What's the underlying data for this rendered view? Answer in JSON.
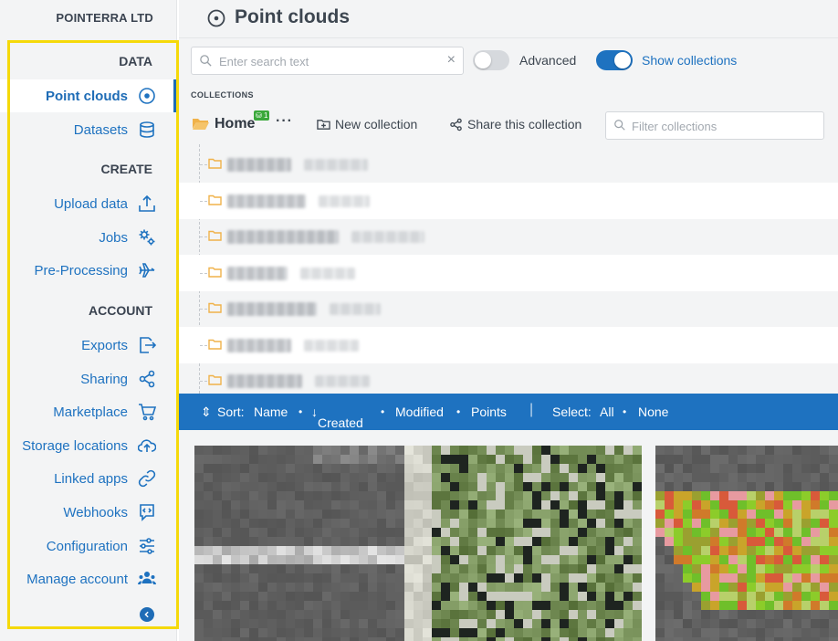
{
  "sidebar": {
    "org_name": "POINTERRA LTD",
    "sections": {
      "data": "DATA",
      "create": "CREATE",
      "account": "ACCOUNT"
    },
    "items": [
      {
        "label": "Point clouds",
        "icon": "target-icon",
        "active": true
      },
      {
        "label": "Datasets",
        "icon": "database-icon"
      },
      {
        "label": "Upload data",
        "icon": "upload-icon"
      },
      {
        "label": "Jobs",
        "icon": "gears-icon"
      },
      {
        "label": "Pre-Processing",
        "icon": "plane-icon"
      },
      {
        "label": "Exports",
        "icon": "export-icon"
      },
      {
        "label": "Sharing",
        "icon": "share-icon"
      },
      {
        "label": "Marketplace",
        "icon": "cart-icon"
      },
      {
        "label": "Storage locations",
        "icon": "cloud-upload-icon"
      },
      {
        "label": "Linked apps",
        "icon": "link-icon"
      },
      {
        "label": "Webhooks",
        "icon": "webhook-icon"
      },
      {
        "label": "Configuration",
        "icon": "sliders-icon"
      },
      {
        "label": "Manage account",
        "icon": "users-icon"
      }
    ],
    "collapse_icon": "chevron-left-icon"
  },
  "header": {
    "title": "Point clouds",
    "icon": "target-icon"
  },
  "toolbar": {
    "search_placeholder": "Enter search text",
    "advanced_label": "Advanced",
    "advanced_on": false,
    "show_collections_label": "Show collections",
    "show_collections_on": true
  },
  "collections": {
    "caption": "COLLECTIONS",
    "home_label": "Home",
    "home_badge": "1",
    "more": "···",
    "new_collection": "New collection",
    "share_collection": "Share this collection",
    "filter_placeholder": "Filter collections",
    "rows": 7
  },
  "sortbar": {
    "sort_label": "Sort:",
    "options": [
      "Name",
      "Created",
      "Modified",
      "Points"
    ],
    "active_sort": "Created",
    "select_label": "Select:",
    "select_options": [
      "All",
      "None"
    ]
  },
  "colors": {
    "accent": "#1e72c0",
    "highlight_box": "#f5d90a",
    "folder": "#f0b24a"
  }
}
